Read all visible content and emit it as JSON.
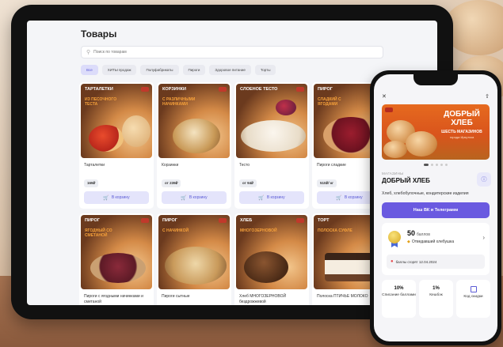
{
  "tablet": {
    "page_title": "Товары",
    "search_placeholder": "Поиск по товарам",
    "chips": [
      "Все",
      "ХИТЫ продаж",
      "Полуфабрикаты",
      "Пироги",
      "Здоровое питание",
      "Торты"
    ],
    "cart_label": "В корзину",
    "products": [
      {
        "promo_title": "Тарталетки",
        "promo_sub": "из песочного теста",
        "name": "Тарталетки",
        "price": "169₽"
      },
      {
        "promo_title": "Корзинки",
        "promo_sub": "с различными начинками",
        "name": "Корзинки",
        "price": "от 239₽"
      },
      {
        "promo_title": "Слоеное тесто",
        "promo_sub": "",
        "name": "Тесто",
        "price": "от 94₽"
      },
      {
        "promo_title": "Пирог",
        "promo_sub": "сладкий с ягодами",
        "name": "Пироги сладкие",
        "price": "510₽/ кг"
      },
      {
        "promo_title": "Пирог",
        "promo_sub": "ягодный со сметаной",
        "name": "Пироги с ягодными начинками и сметаной"
      },
      {
        "promo_title": "Пирог",
        "promo_sub": "с начинкой",
        "name": "Пироги сытные"
      },
      {
        "promo_title": "Хлеб",
        "promo_sub": "многозерновой",
        "name": "Хлеб МНОГОЗЕРНОВОЙ бездрожжевой"
      },
      {
        "promo_title": "Торт",
        "promo_sub": "Полоска суфле",
        "name": "Полоска ПТИЧЬЕ МОЛОКО"
      }
    ]
  },
  "phone": {
    "banner_title": "ДОБРЫЙ ХЛЕБ",
    "banner_sub": "ШЕСТЬ МАГАЗИНОВ",
    "banner_city": "города Иркутска",
    "shop_caption": "МАГАЗИНЫ",
    "shop_name": "ДОБРЫЙ ХЛЕБ",
    "shop_desc": "Хлеб, хлебобулочные, кондитерские изделия",
    "cta": "Наш ВК и Телеграмм",
    "points_value": "50",
    "points_label": "баллов",
    "level": "Отведавший хлебушка",
    "expire": "баллы сгорят 12.04.2024",
    "tiles": [
      {
        "value": "10%",
        "label": "Списание баллами"
      },
      {
        "value": "1%",
        "label": "Кешбэк"
      },
      {
        "value": "",
        "label": "Код скидки"
      }
    ]
  }
}
